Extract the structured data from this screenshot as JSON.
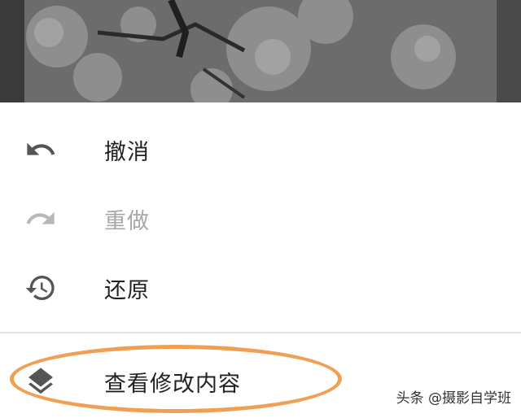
{
  "menu": {
    "items": [
      {
        "label": "撤消",
        "icon": "undo-icon",
        "enabled": true
      },
      {
        "label": "重做",
        "icon": "redo-icon",
        "enabled": false
      },
      {
        "label": "还原",
        "icon": "history-icon",
        "enabled": true
      },
      {
        "label": "查看修改内容",
        "icon": "layers-icon",
        "enabled": true
      }
    ]
  },
  "watermark": {
    "text": "头条 @摄影自学班"
  },
  "colors": {
    "highlight": "#f0a055",
    "icon": "#555555",
    "disabled": "#a8a8a8",
    "divider": "#e3e3e3"
  }
}
